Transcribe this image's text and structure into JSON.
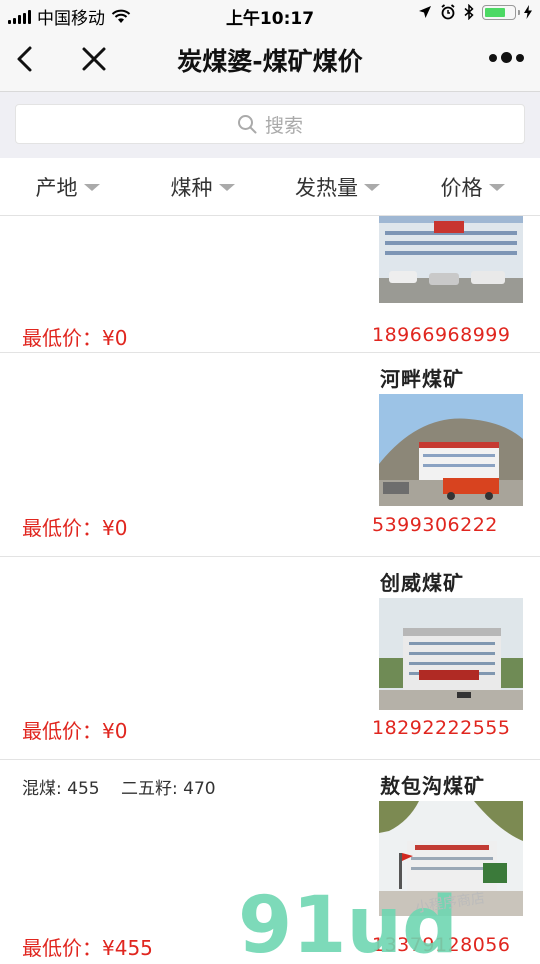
{
  "status_bar": {
    "carrier": "中国移动",
    "time": "上午10:17"
  },
  "nav": {
    "title": "炭煤婆-煤矿煤价",
    "back_icon": "chevron-left-icon",
    "close_icon": "close-icon",
    "more_icon": "more-dots-icon"
  },
  "search": {
    "placeholder": "搜索"
  },
  "filters": [
    {
      "label": "产地"
    },
    {
      "label": "煤种"
    },
    {
      "label": "发热量"
    },
    {
      "label": "价格"
    }
  ],
  "listings": [
    {
      "name": "",
      "prices_text": [],
      "min_price": "最低价：¥0",
      "phone": "18966968999"
    },
    {
      "name": "河畔煤矿",
      "prices_text": [],
      "min_price": "最低价：¥0",
      "phone": "5399306222"
    },
    {
      "name": "创威煤矿",
      "prices_text": [],
      "min_price": "最低价：¥0",
      "phone": "18292222555"
    },
    {
      "name": "敖包沟煤矿",
      "prices_text": [
        "混煤: 455",
        "二五籽: 470"
      ],
      "min_price": "最低价：¥455",
      "phone": "13379128056"
    }
  ],
  "watermark": {
    "logo": "91ud",
    "tagline": "小程序商店"
  },
  "colors": {
    "price_red": "#e0261f",
    "nav_bg": "#f7f7f7",
    "search_bg": "#efeff4",
    "battery_green": "#4cd964"
  }
}
